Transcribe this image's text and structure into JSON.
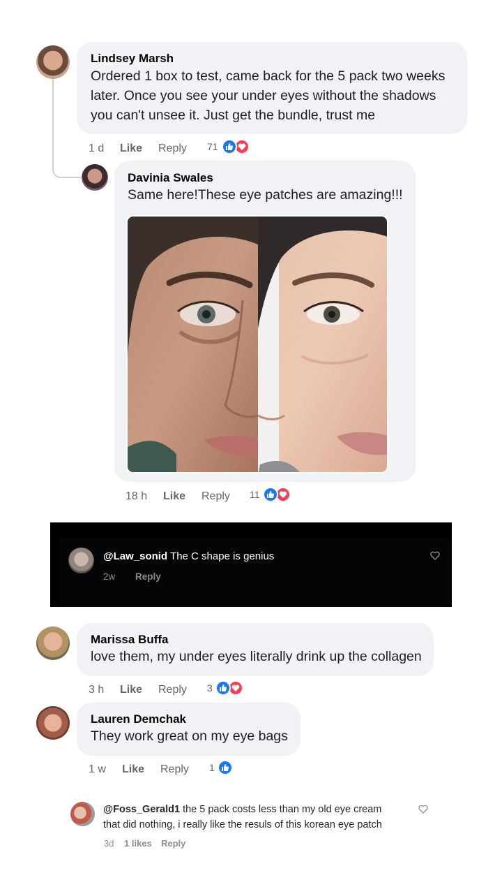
{
  "comments": [
    {
      "name": "Lindsey Marsh",
      "lines": [
        "Ordered 1 box to test, came back for the 5 pack two weeks",
        "later. Once you see your under eyes without the shadows",
        "you can't unsee it. Just get the bundle, trust me"
      ],
      "time": "1 d",
      "like": "Like",
      "reply": "Reply",
      "reactions": "71",
      "reaction_types": [
        "like",
        "love"
      ]
    },
    {
      "name": "Davinia Swales",
      "lines": [
        "Same here!These eye patches are amazing!!!"
      ],
      "time": "18 h",
      "like": "Like",
      "reply": "Reply",
      "reactions": "11",
      "reaction_types": [
        "like",
        "love"
      ]
    },
    {
      "name": "Marissa Buffa",
      "lines": [
        "love them, my under eyes literally drink up the collagen"
      ],
      "time": "3 h",
      "like": "Like",
      "reply": "Reply",
      "reactions": "3",
      "reaction_types": [
        "like",
        "love"
      ]
    },
    {
      "name": "Lauren Demchak",
      "lines": [
        "They work great on my eye bags"
      ],
      "time": "1 w",
      "like": "Like",
      "reply": "Reply",
      "reactions": "1",
      "reaction_types": [
        "like"
      ]
    }
  ],
  "tiktok_comment": {
    "username": "@Law_sonid",
    "text": "The C shape is genius",
    "time": "2w",
    "reply": "Reply"
  },
  "instagram_comment": {
    "username": "@Foss_Gerald1",
    "line1": "the 5 pack costs less than my old eye cream",
    "line2": "that did nothing, i really like the resuls of this korean eye patch",
    "time": "3d",
    "likes": "1 likes",
    "reply": "Reply"
  },
  "colors": {
    "like_blue": "#1877f2",
    "love_red": "#f33e58",
    "bubble_gray": "#f0f2f5"
  },
  "icons": [
    "thumbs-up-icon",
    "heart-icon",
    "heart-outline-icon"
  ]
}
